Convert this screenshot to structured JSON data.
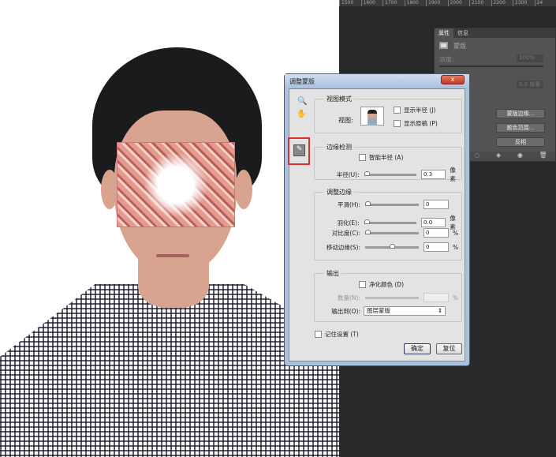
{
  "ruler": {
    "ticks": [
      "1500",
      "1600",
      "1700",
      "1800",
      "1900",
      "2000",
      "2100",
      "2200",
      "2300",
      "24"
    ]
  },
  "properties_panel": {
    "tabs": [
      "属性",
      "信息"
    ],
    "mask_label": "蒙版",
    "density_label": "浓度:",
    "density_value": "100%",
    "feather_value": "0.0 像素",
    "buttons": [
      "蒙版边缘...",
      "颜色范围...",
      "反相"
    ]
  },
  "dialog": {
    "title": "调整蒙版",
    "close": "x",
    "view_mode": {
      "title": "视图模式",
      "view_label": "视图:",
      "show_radius": "显示半径 (J)",
      "show_original": "显示原稿 (P)"
    },
    "edge_detection": {
      "title": "边缘检测",
      "smart_radius": "智能半径 (A)",
      "radius_label": "半径(U):",
      "radius_value": "0.3",
      "radius_unit": "像素"
    },
    "adjust_edge": {
      "title": "调整边缘",
      "rows": [
        {
          "label": "平滑(H):",
          "value": "0",
          "unit": "",
          "pos": 0
        },
        {
          "label": "羽化(E):",
          "value": "0.0",
          "unit": "像素",
          "pos": 0
        },
        {
          "label": "对比度(C):",
          "value": "0",
          "unit": "%",
          "pos": 0
        },
        {
          "label": "移动边缘(S):",
          "value": "0",
          "unit": "%",
          "pos": 50
        }
      ]
    },
    "output": {
      "title": "输出",
      "decontaminate": "净化颜色 (D)",
      "amount_label": "数量(N):",
      "amount_unit": "%",
      "output_to_label": "输出到(O):",
      "output_to_value": "图层蒙版"
    },
    "remember": "记住设置 (T)",
    "ok": "确定",
    "reset": "复位"
  }
}
